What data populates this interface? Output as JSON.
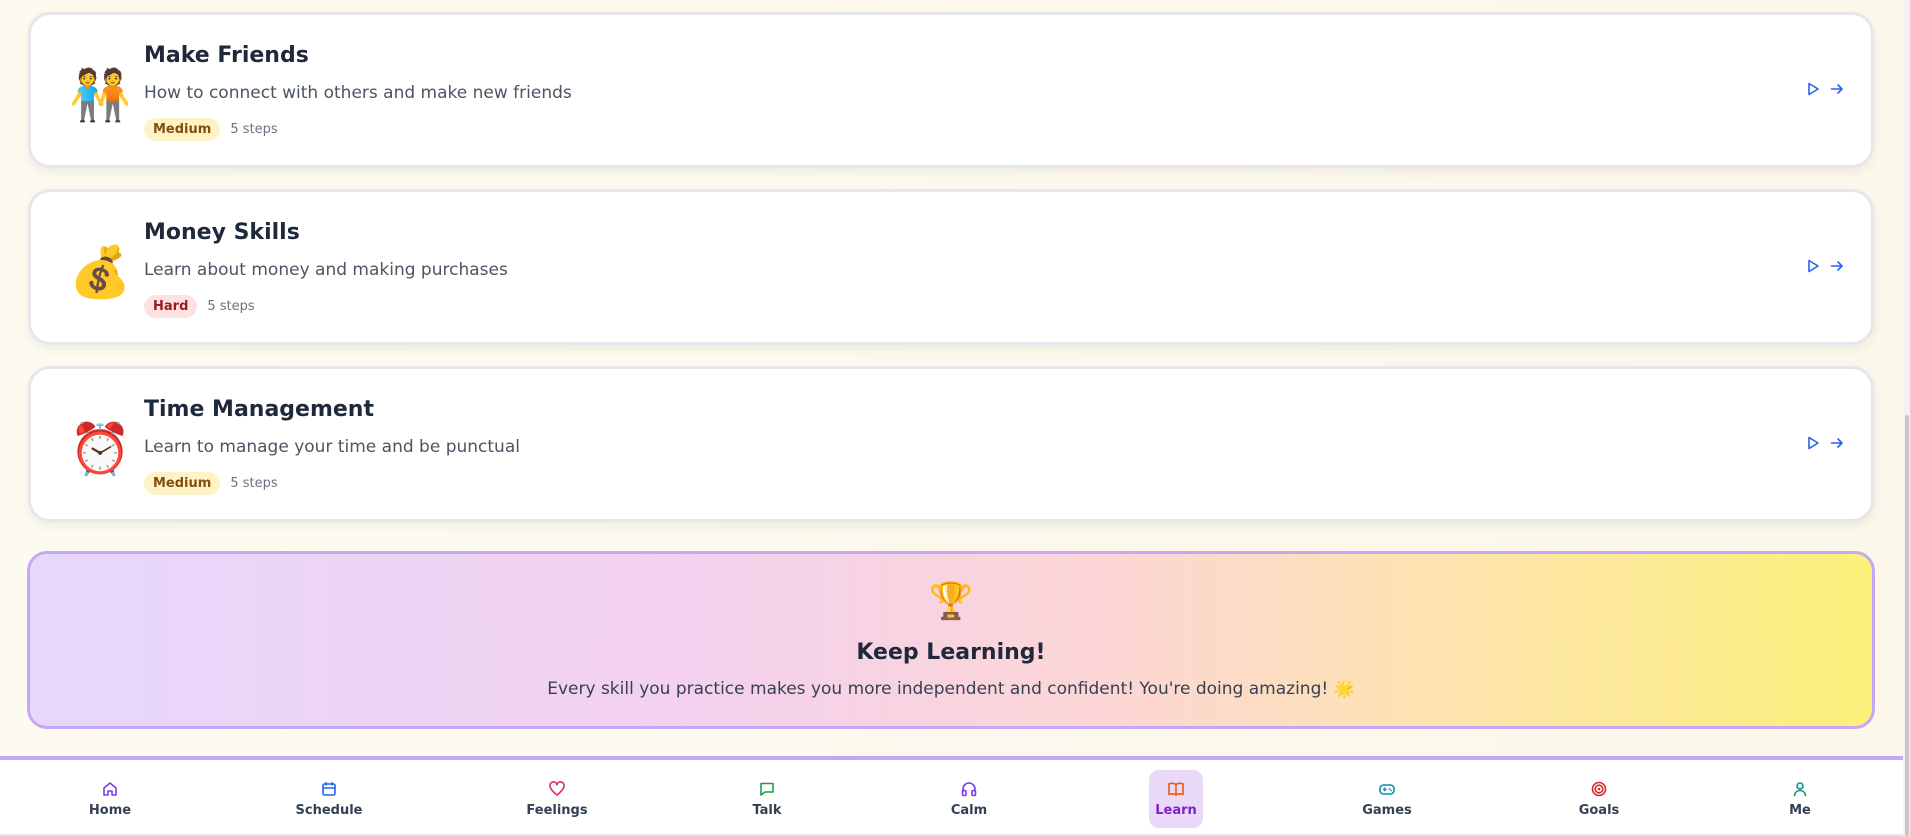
{
  "lessons": [
    {
      "emoji": "🧑‍🤝‍🧑",
      "title": "Make Friends",
      "description": "How to connect with others and make new friends",
      "difficulty": "Medium",
      "steps": "5 steps"
    },
    {
      "emoji": "💰",
      "title": "Money Skills",
      "description": "Learn about money and making purchases",
      "difficulty": "Hard",
      "steps": "5 steps"
    },
    {
      "emoji": "⏰",
      "title": "Time Management",
      "description": "Learn to manage your time and be punctual",
      "difficulty": "Medium",
      "steps": "5 steps"
    }
  ],
  "banner": {
    "icon": "🏆",
    "title": "Keep Learning!",
    "text": "Every skill you practice makes you more independent and confident! You're doing amazing! 🌟"
  },
  "nav": {
    "items": [
      {
        "label": "Home",
        "icon": "home-icon",
        "color": "#7c3aed"
      },
      {
        "label": "Schedule",
        "icon": "calendar-icon",
        "color": "#2563eb"
      },
      {
        "label": "Feelings",
        "icon": "heart-icon",
        "color": "#db2777"
      },
      {
        "label": "Talk",
        "icon": "chat-icon",
        "color": "#16a34a"
      },
      {
        "label": "Calm",
        "icon": "headphones-icon",
        "color": "#7c3aed"
      },
      {
        "label": "Learn",
        "icon": "book-icon",
        "color": "#ea580c"
      },
      {
        "label": "Games",
        "icon": "gamepad-icon",
        "color": "#0891b2"
      },
      {
        "label": "Goals",
        "icon": "target-icon",
        "color": "#dc2626"
      },
      {
        "label": "Me",
        "icon": "user-icon",
        "color": "#0d9488"
      }
    ],
    "active": "Learn",
    "active_label_color": "#7e22ce",
    "label_color": "#334155"
  },
  "colors": {
    "action_blue": "#2563eb",
    "banner_border": "#c4a8f5"
  }
}
